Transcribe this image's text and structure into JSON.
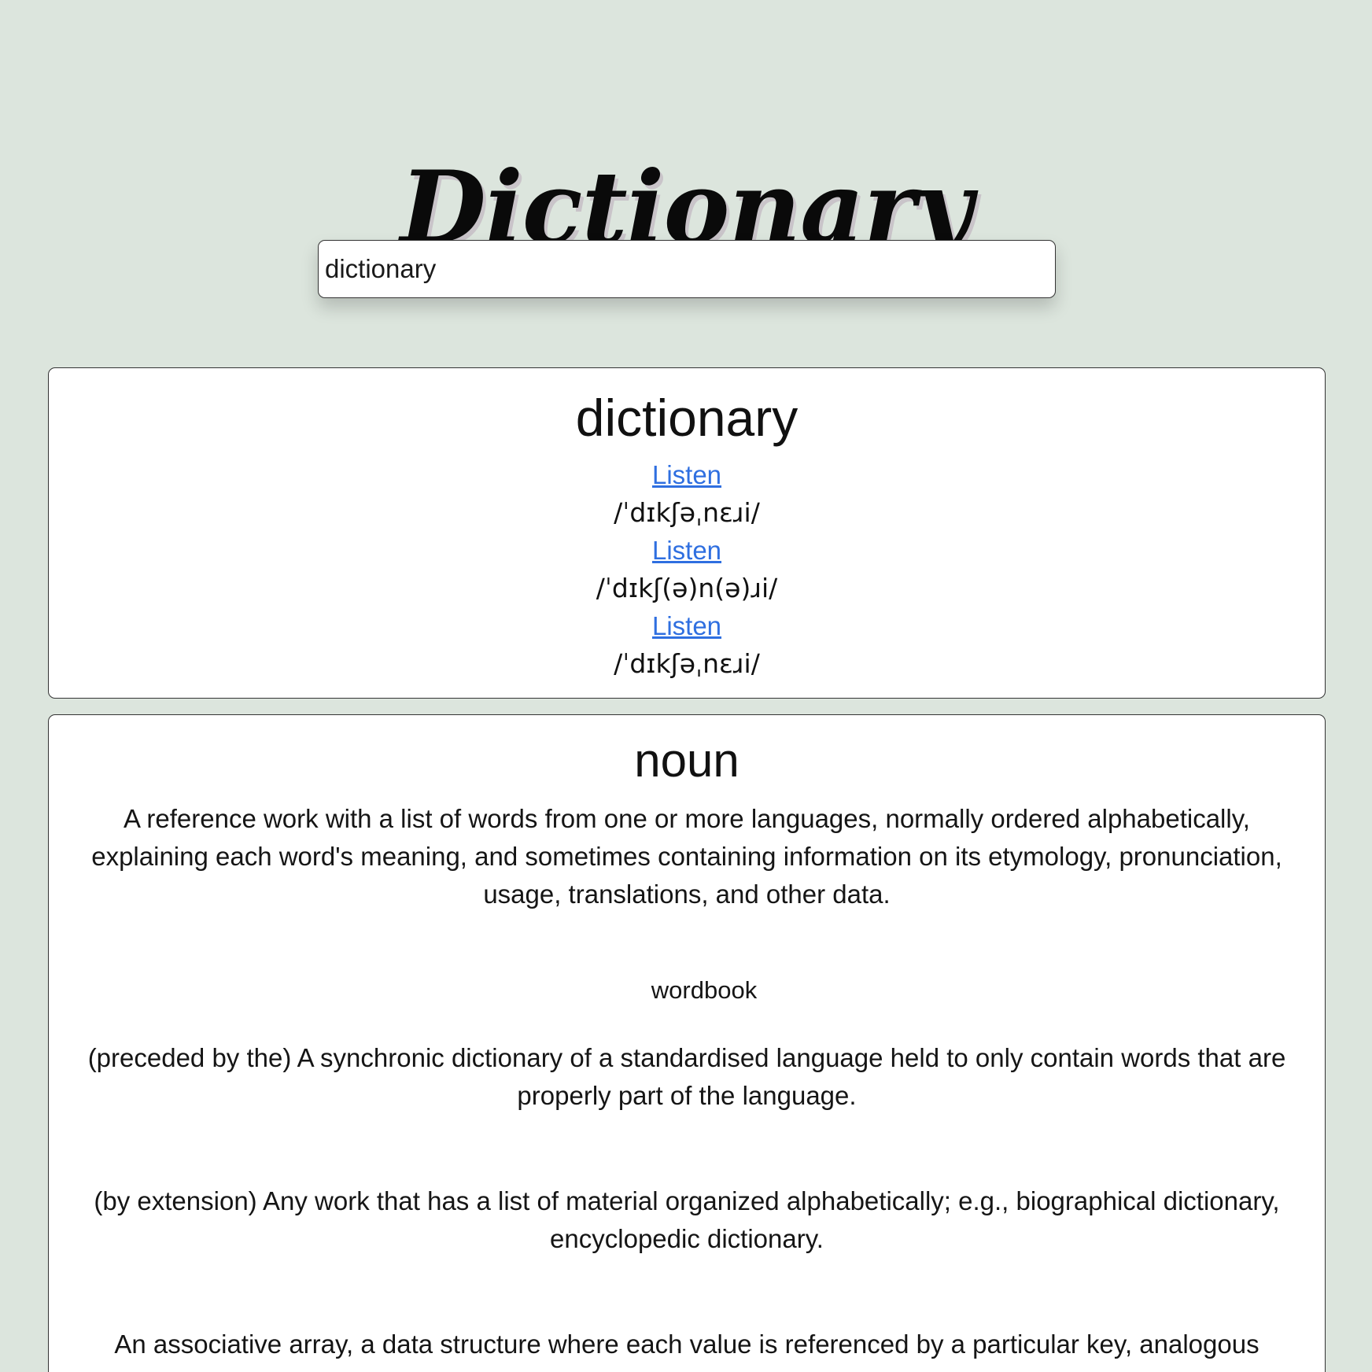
{
  "app": {
    "title": "Dictionary"
  },
  "search": {
    "value": "dictionary"
  },
  "entry": {
    "word": "dictionary",
    "phonetics": [
      {
        "listen_label": "Listen",
        "text": "/ˈdɪkʃəˌnɛɹi/"
      },
      {
        "listen_label": "Listen",
        "text": "/ˈdɪkʃ(ə)n(ə)ɹi/"
      },
      {
        "listen_label": "Listen",
        "text": "/ˈdɪkʃəˌnɛɹi/"
      }
    ]
  },
  "meaning": {
    "part_of_speech": "noun",
    "definitions": [
      "A reference work with a list of words from one or more languages, normally ordered alphabetically, explaining each word's meaning, and sometimes containing information on its etymology, pronunciation, usage, translations, and other data.",
      "(preceded by the) A synchronic dictionary of a standardised language held to only contain words that are properly part of the language.",
      "(by extension) Any work that has a list of material organized alphabetically; e.g., biographical dictionary, encyclopedic dictionary.",
      "An associative array, a data structure where each value is referenced by a particular key, analogous"
    ],
    "synonym": "wordbook"
  }
}
